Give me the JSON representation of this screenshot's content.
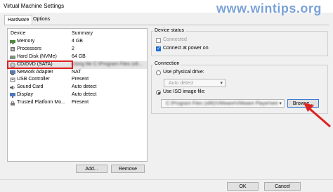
{
  "window": {
    "title": "Virtual Machine Settings",
    "watermark": "www.wintips.org"
  },
  "tabs": [
    {
      "label": "Hardware"
    },
    {
      "label": "Options"
    }
  ],
  "device_list": {
    "headers": {
      "device": "Device",
      "summary": "Summary"
    },
    "rows": [
      {
        "device": "Memory",
        "summary": "4 GB",
        "icon": "memory-icon"
      },
      {
        "device": "Processors",
        "summary": "2",
        "icon": "processor-icon"
      },
      {
        "device": "Hard Disk (NVMe)",
        "summary": "64 GB",
        "icon": "hard-disk-icon"
      },
      {
        "device": "CD/DVD (SATA)",
        "summary": "Using file C:\\Program Files (x8...",
        "icon": "cd-dvd-icon"
      },
      {
        "device": "Network Adapter",
        "summary": "NAT",
        "icon": "network-adapter-icon"
      },
      {
        "device": "USB Controller",
        "summary": "Present",
        "icon": "usb-controller-icon"
      },
      {
        "device": "Sound Card",
        "summary": "Auto detect",
        "icon": "sound-card-icon"
      },
      {
        "device": "Display",
        "summary": "Auto detect",
        "icon": "display-icon"
      },
      {
        "device": "Trusted Platform Mo...",
        "summary": "Present",
        "icon": "trusted-platform-module-icon"
      }
    ],
    "selected_index": 3,
    "add_label": "Add...",
    "remove_label": "Remove"
  },
  "device_status": {
    "title": "Device status",
    "connected_label": "Connected",
    "connected_checked": false,
    "connect_power_on_label": "Connect at power on",
    "connect_power_on_checked": true
  },
  "connection": {
    "title": "Connection",
    "physical_label": "Use physical drive:",
    "physical_selected": false,
    "physical_value": "Auto detect",
    "iso_label": "Use ISO image file:",
    "iso_selected": true,
    "iso_value": "C:\\Program Files (x86)\\VMware\\VMware Player\\win...",
    "browse_label": "Browse..."
  },
  "footer": {
    "ok_label": "OK",
    "cancel_label": "Cancel"
  },
  "colors": {
    "highlight_box": "#e02020",
    "annotation_arrow": "#e02020",
    "accent": "#1f6fd0"
  }
}
